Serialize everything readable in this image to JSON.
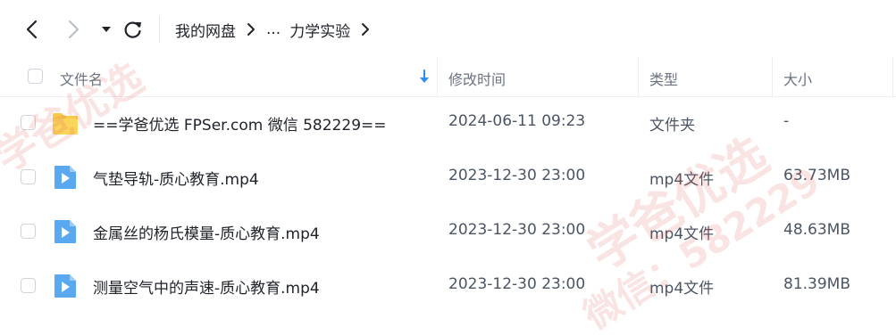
{
  "breadcrumb": {
    "root": "我的网盘",
    "ellipsis": "...",
    "current": "力学实验"
  },
  "header": {
    "name": "文件名",
    "modified": "修改时间",
    "type": "类型",
    "size": "大小"
  },
  "files": [
    {
      "name": "==学爸优选 FPSer.com 微信 582229==",
      "modified": "2024-06-11 09:23",
      "type": "文件夹",
      "size": "-",
      "icon": "folder-icon"
    },
    {
      "name": "气垫导轨-质心教育.mp4",
      "modified": "2023-12-30 23:00",
      "type": "mp4文件",
      "size": "63.73MB",
      "icon": "video-file-icon"
    },
    {
      "name": "金属丝的杨氏模量-质心教育.mp4",
      "modified": "2023-12-30 23:00",
      "type": "mp4文件",
      "size": "48.63MB",
      "icon": "video-file-icon"
    },
    {
      "name": "测量空气中的声速-质心教育.mp4",
      "modified": "2023-12-30 23:00",
      "type": "mp4文件",
      "size": "81.39MB",
      "icon": "video-file-icon"
    }
  ],
  "watermark": {
    "line1": "学爸优选",
    "line2": "微信：582229"
  },
  "colors": {
    "folder": "#f7c948",
    "video": "#5aa8f0",
    "accent": "#2b8ef0",
    "watermark": "#dc5050"
  }
}
